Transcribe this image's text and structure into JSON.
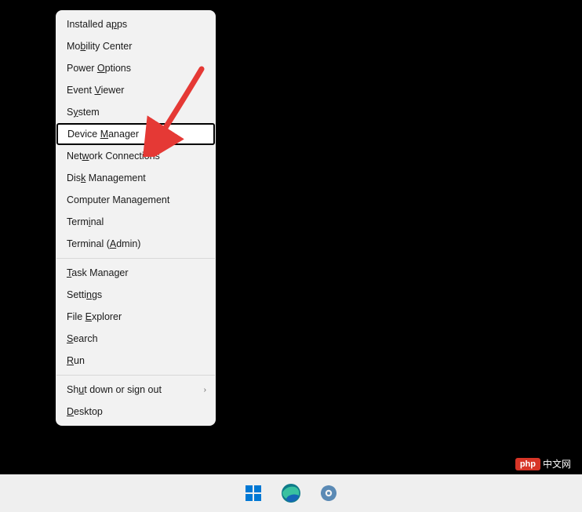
{
  "menu": {
    "groups": [
      [
        {
          "id": "installed-apps",
          "pre": "Installed a",
          "u": "p",
          "post": "ps",
          "hl": false,
          "sub": false
        },
        {
          "id": "mobility-center",
          "pre": "Mo",
          "u": "b",
          "post": "ility Center",
          "hl": false,
          "sub": false
        },
        {
          "id": "power-options",
          "pre": "Power ",
          "u": "O",
          "post": "ptions",
          "hl": false,
          "sub": false
        },
        {
          "id": "event-viewer",
          "pre": "Event ",
          "u": "V",
          "post": "iewer",
          "hl": false,
          "sub": false
        },
        {
          "id": "system",
          "pre": "S",
          "u": "y",
          "post": "stem",
          "hl": false,
          "sub": false
        },
        {
          "id": "device-manager",
          "pre": "Device ",
          "u": "M",
          "post": "anager",
          "hl": true,
          "sub": false
        },
        {
          "id": "network-connections",
          "pre": "Net",
          "u": "w",
          "post": "ork Connections",
          "hl": false,
          "sub": false
        },
        {
          "id": "disk-management",
          "pre": "Dis",
          "u": "k",
          "post": " Management",
          "hl": false,
          "sub": false
        },
        {
          "id": "computer-management",
          "pre": "Computer Mana",
          "u": "g",
          "post": "ement",
          "hl": false,
          "sub": false
        },
        {
          "id": "terminal",
          "pre": "Term",
          "u": "i",
          "post": "nal",
          "hl": false,
          "sub": false
        },
        {
          "id": "terminal-admin",
          "pre": "Terminal (",
          "u": "A",
          "post": "dmin)",
          "hl": false,
          "sub": false
        }
      ],
      [
        {
          "id": "task-manager",
          "pre": "",
          "u": "T",
          "post": "ask Manager",
          "hl": false,
          "sub": false
        },
        {
          "id": "settings",
          "pre": "Setti",
          "u": "n",
          "post": "gs",
          "hl": false,
          "sub": false
        },
        {
          "id": "file-explorer",
          "pre": "File ",
          "u": "E",
          "post": "xplorer",
          "hl": false,
          "sub": false
        },
        {
          "id": "search",
          "pre": "",
          "u": "S",
          "post": "earch",
          "hl": false,
          "sub": false
        },
        {
          "id": "run",
          "pre": "",
          "u": "R",
          "post": "un",
          "hl": false,
          "sub": false
        }
      ],
      [
        {
          "id": "shut-down",
          "pre": "Sh",
          "u": "u",
          "post": "t down or sign out",
          "hl": false,
          "sub": true
        },
        {
          "id": "desktop",
          "pre": "",
          "u": "D",
          "post": "esktop",
          "hl": false,
          "sub": false
        }
      ]
    ]
  },
  "watermark": {
    "badge": "php",
    "text": "中文网"
  },
  "annotation": {
    "arrow_color": "#e53935"
  }
}
